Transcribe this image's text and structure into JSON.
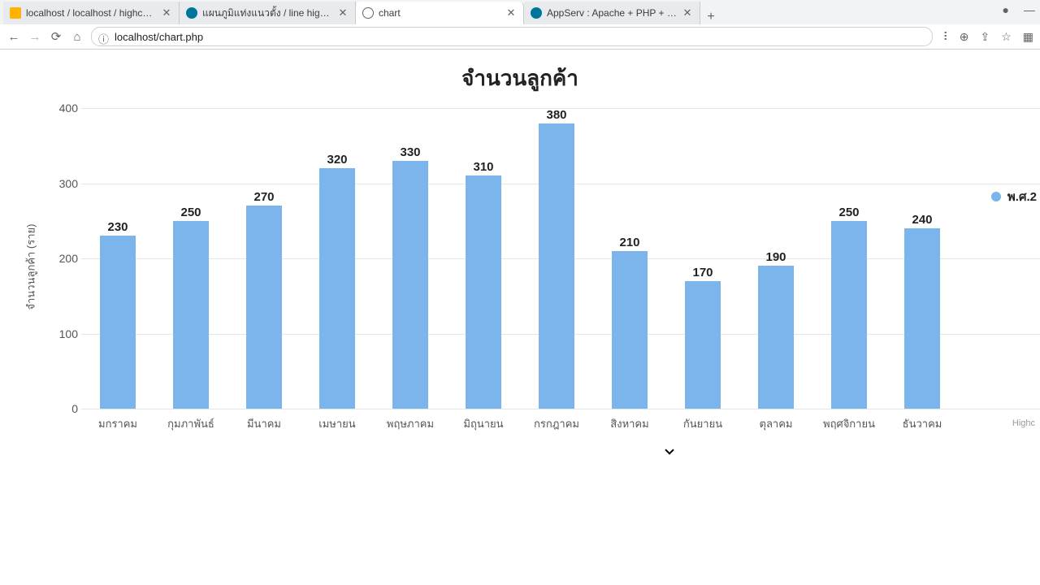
{
  "chrome": {
    "tabs": [
      {
        "title": "localhost / localhost / highcharts",
        "favicon": "pma"
      },
      {
        "title": "แผนภูมิแท่งแนวตั้ง / line highchart",
        "favicon": "wp"
      },
      {
        "title": "chart",
        "favicon": "globe",
        "active": true
      },
      {
        "title": "AppServ : Apache + PHP + MYSQL",
        "favicon": "wp"
      }
    ],
    "url": "localhost/chart.php"
  },
  "legend_label": "พ.ศ.2",
  "credit": "Highc",
  "chart_data": {
    "type": "bar",
    "title": "จำนวนลูกค้า",
    "xlabel": "",
    "ylabel": "จำนวนลูกค้า (ราย)",
    "ylim": [
      0,
      400
    ],
    "yticks": [
      0,
      100,
      200,
      300,
      400
    ],
    "grid": true,
    "legend_position": "right",
    "bar_color": "#7cb5ec",
    "categories": [
      "มกราคม",
      "กุมภาพันธ์",
      "มีนาคม",
      "เมษายน",
      "พฤษภาคม",
      "มิถุนายน",
      "กรกฎาคม",
      "สิงหาคม",
      "กันยายน",
      "ตุลาคม",
      "พฤศจิกายน",
      "ธันวาคม"
    ],
    "series": [
      {
        "name": "พ.ศ.2",
        "values": [
          230,
          250,
          270,
          320,
          330,
          310,
          380,
          210,
          170,
          190,
          250,
          240
        ]
      }
    ]
  }
}
